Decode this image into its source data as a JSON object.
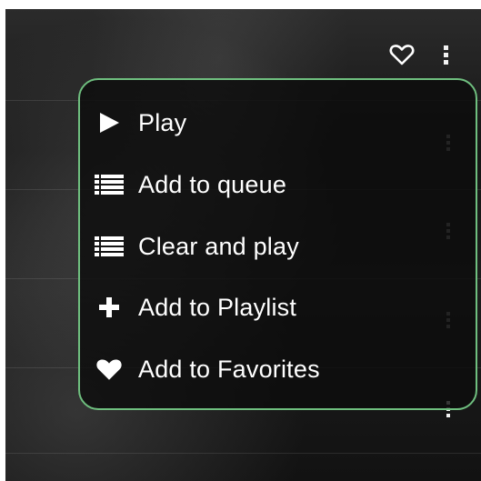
{
  "header": {
    "favorite_icon": "heart-outline-icon",
    "more_icon": "vertical-dots-icon"
  },
  "context_menu": {
    "border_color": "#6fbf7f",
    "items": [
      {
        "label": "Play",
        "icon": "play-icon"
      },
      {
        "label": "Add to queue",
        "icon": "queue-list-icon"
      },
      {
        "label": "Clear and play",
        "icon": "queue-list-icon"
      },
      {
        "label": "Add to Playlist",
        "icon": "plus-icon"
      },
      {
        "label": "Add to Favorites",
        "icon": "heart-icon"
      }
    ]
  }
}
